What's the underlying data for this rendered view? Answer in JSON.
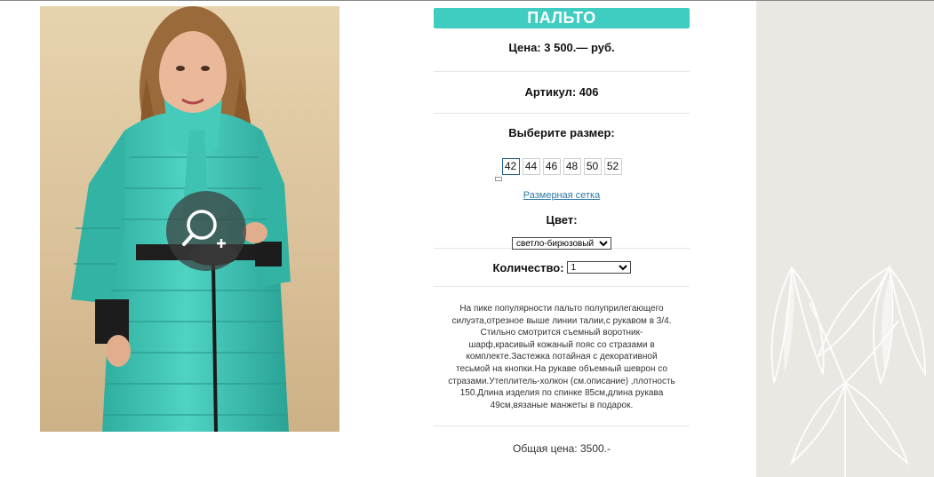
{
  "product": {
    "title": "ПАЛЬТО",
    "price": "Цена: 3 500.— руб.",
    "article": "Артикул: 406",
    "choose_size_label": "Выберите размер:",
    "sizes": [
      "42",
      "44",
      "46",
      "48",
      "50",
      "52"
    ],
    "selected_size": "42",
    "size_chart_link": "Размерная сетка",
    "color_label": "Цвет:",
    "color_value": "светло-бирюзовый",
    "quantity_label": "Количество:",
    "quantity_value": "1",
    "description": "На пике популярности пальто полуприлегающего силуэта,отрезное выше линии талии,с рукавом в 3/4. Стильно смотрится съемный воротник-шарф,красивый кожаный пояс со стразами в комплекте.Застежка потайная с декоративной тесьмой на кнопки.На рукаве объемный шеврон со стразами.Утеплитель-холкон (см.описание) ,плотность 150.Длина изделия по спинке 85см,длина рукава 49см,вязаные манжеты в подарок.",
    "total": "Общая цена: 3500.-"
  },
  "icons": {
    "zoom": "zoom-in-icon"
  },
  "colors": {
    "accent": "#3ecdc0",
    "coat": "#3cbfb0",
    "side_panel": "#ebe8e3",
    "link": "#2b7aa6"
  }
}
